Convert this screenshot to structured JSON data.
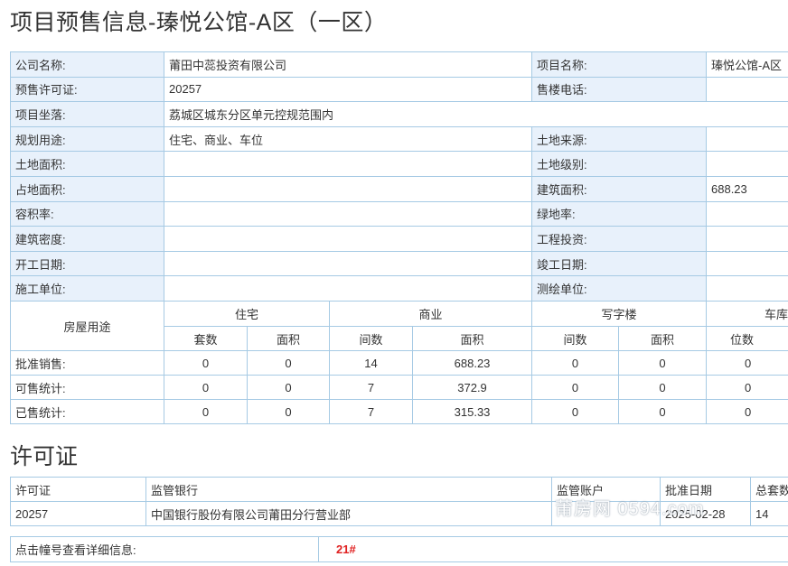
{
  "page": {
    "title": "项目预售信息-瑧悦公馆-A区（一区）"
  },
  "info": {
    "company_label": "公司名称:",
    "company_value": "莆田中蕊投资有限公司",
    "project_name_label": "项目名称:",
    "project_name_value": "瑧悦公馆-A区",
    "permit_label": "预售许可证:",
    "permit_value": "20257",
    "phone_label": "售楼电话:",
    "phone_value": "",
    "location_label": "项目坐落:",
    "location_value": "荔城区城东分区单元控规范围内",
    "usage_label": "规划用途:",
    "usage_value": "住宅、商业、车位",
    "land_source_label": "土地来源:",
    "land_source_value": "",
    "land_area_label": "土地面积:",
    "land_area_value": "",
    "land_grade_label": "土地级别:",
    "land_grade_value": "",
    "occupied_area_label": "占地面积:",
    "occupied_area_value": "",
    "build_area_label": "建筑面积:",
    "build_area_value": "688.23",
    "far_label": "容积率:",
    "far_value": "",
    "green_label": "绿地率:",
    "green_value": "",
    "density_label": "建筑密度:",
    "density_value": "",
    "investment_label": "工程投资:",
    "investment_value": "",
    "start_label": "开工日期:",
    "start_value": "",
    "finish_label": "竣工日期:",
    "finish_value": "",
    "builder_label": "施工单位:",
    "builder_value": "",
    "surveyor_label": "测绘单位:",
    "surveyor_value": ""
  },
  "stats": {
    "usage_header": "房屋用途",
    "groups": [
      "住宅",
      "商业",
      "写字楼",
      "车库"
    ],
    "subheaders": [
      "套数",
      "面积",
      "间数",
      "面积",
      "间数",
      "面积",
      "位数"
    ],
    "rows": [
      {
        "label": "批准销售:",
        "values": [
          "0",
          "0",
          "14",
          "688.23",
          "0",
          "0",
          "0"
        ]
      },
      {
        "label": "可售统计:",
        "values": [
          "0",
          "0",
          "7",
          "372.9",
          "0",
          "0",
          "0"
        ]
      },
      {
        "label": "已售统计:",
        "values": [
          "0",
          "0",
          "7",
          "315.33",
          "0",
          "0",
          "0"
        ]
      }
    ]
  },
  "permit_section": {
    "title": "许可证",
    "headers": [
      "许可证",
      "监管银行",
      "监管账户",
      "批准日期",
      "总套数"
    ],
    "row": [
      "20257",
      "中国银行股份有限公司莆田分行营业部",
      "",
      "2025-02-28",
      "14"
    ]
  },
  "detail": {
    "label": "点击幢号查看详细信息:",
    "building_link": "21#"
  },
  "watermark": "莆房网 0594.com",
  "colors": {
    "border": "#a6cae4",
    "label_bg": "#e8f1fb",
    "link_red": "#e02020"
  }
}
